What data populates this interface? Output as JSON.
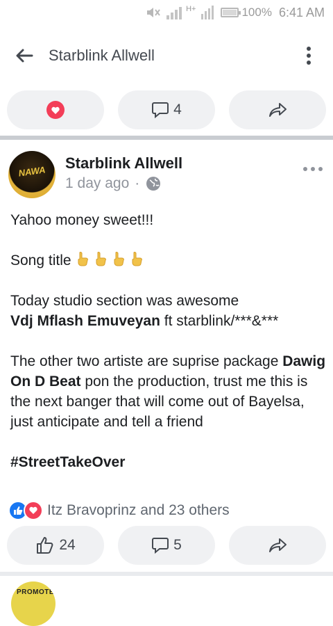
{
  "status_bar": {
    "battery": "100%",
    "time": "6:41 AM",
    "network": "H+"
  },
  "app_bar": {
    "title": "Starblink Allwell"
  },
  "top_actions": {
    "comments_count": "4"
  },
  "post": {
    "author": "Starblink Allwell",
    "time": "1 day ago",
    "separator": "·",
    "avatar_text": "NAWA",
    "lines": {
      "l1": "Yahoo money sweet!!!",
      "l2": "Song title",
      "l3": "Today studio section was awesome",
      "l4_bold": "Vdj Mflash Emuveyan",
      "l4_rest": " ft starblink/***&***",
      "l5": "The other two artiste are suprise package ",
      "l5_bold": "Dawig On D Beat",
      "l5_rest": " pon the production, trust me this is the next banger that will come out of Bayelsa, just anticipate and tell a friend",
      "hashtag": "#StreetTakeOver"
    },
    "reactions_text": "Itz Bravoprinz and 23 others",
    "likes_count": "24",
    "comments_count": "5"
  },
  "next_post": {
    "avatar_text": "PROMOTE"
  },
  "colors": {
    "accent": "#1877f2",
    "love": "#f33e58",
    "pill_bg": "#f0f1f3"
  },
  "icons": [
    "muted-icon",
    "signal-icon",
    "battery-icon",
    "back-arrow-icon",
    "more-vert-icon",
    "heart-icon",
    "comment-icon",
    "share-icon",
    "globe-icon",
    "more-horiz-icon",
    "like-icon",
    "hand-point-icon"
  ]
}
